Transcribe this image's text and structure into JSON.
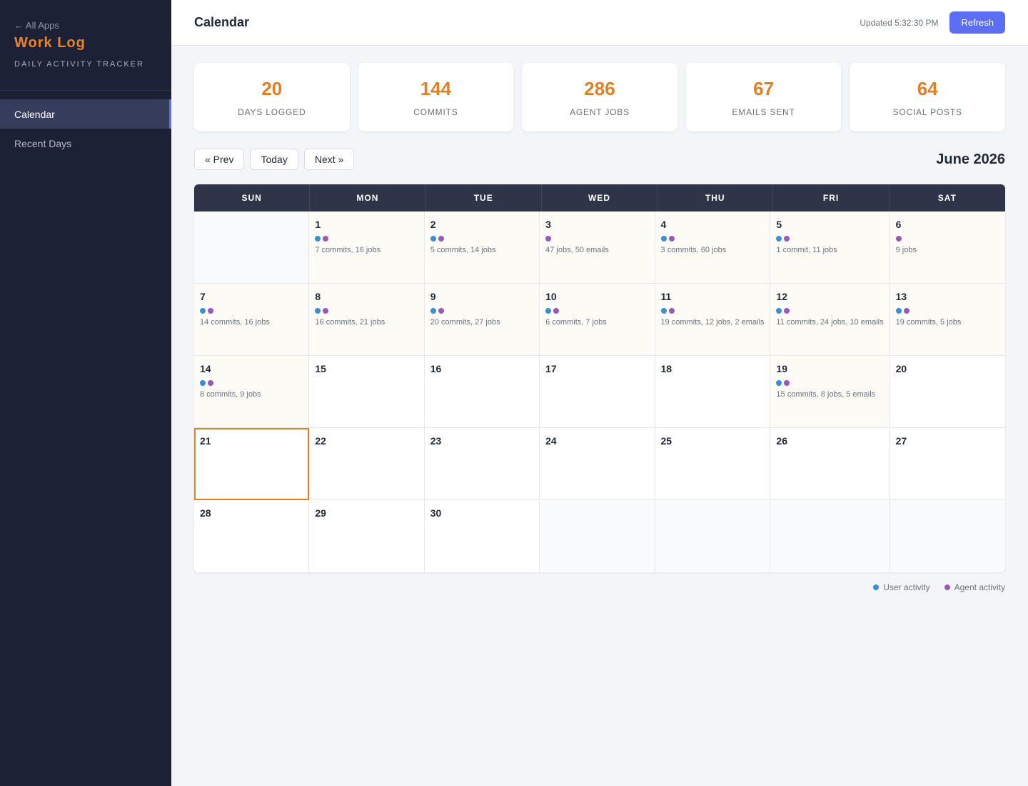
{
  "sidebar": {
    "back_link": "← All Apps",
    "title": "Work Log",
    "subtitle": "DAILY ACTIVITY TRACKER",
    "nav": [
      {
        "label": "Calendar",
        "active": true
      },
      {
        "label": "Recent Days",
        "active": false
      }
    ]
  },
  "header": {
    "title": "Calendar",
    "updated": "Updated 5:32:30 PM",
    "refresh_label": "Refresh"
  },
  "stats": [
    {
      "value": "20",
      "label": "DAYS LOGGED"
    },
    {
      "value": "144",
      "label": "COMMITS"
    },
    {
      "value": "286",
      "label": "AGENT JOBS"
    },
    {
      "value": "67",
      "label": "EMAILS SENT"
    },
    {
      "value": "64",
      "label": "SOCIAL POSTS"
    }
  ],
  "controls": {
    "prev_label": "« Prev",
    "today_label": "Today",
    "next_label": "Next »",
    "month_title": "June 2026"
  },
  "calendar": {
    "weekdays": [
      "SUN",
      "MON",
      "TUE",
      "WED",
      "THU",
      "FRI",
      "SAT"
    ],
    "leading_blanks": 1,
    "trailing_blanks": 4,
    "today": 21,
    "days": [
      {
        "day": "1",
        "user": true,
        "agent": true,
        "summary": "7 commits, 16 jobs"
      },
      {
        "day": "2",
        "user": true,
        "agent": true,
        "summary": "5 commits, 14 jobs"
      },
      {
        "day": "3",
        "user": false,
        "agent": true,
        "summary": "47 jobs, 50 emails"
      },
      {
        "day": "4",
        "user": true,
        "agent": true,
        "summary": "3 commits, 60 jobs"
      },
      {
        "day": "5",
        "user": true,
        "agent": true,
        "summary": "1 commit, 11 jobs"
      },
      {
        "day": "6",
        "user": false,
        "agent": true,
        "summary": "9 jobs"
      },
      {
        "day": "7",
        "user": true,
        "agent": true,
        "summary": "14 commits, 16 jobs"
      },
      {
        "day": "8",
        "user": true,
        "agent": true,
        "summary": "16 commits, 21 jobs"
      },
      {
        "day": "9",
        "user": true,
        "agent": true,
        "summary": "20 commits, 27 jobs"
      },
      {
        "day": "10",
        "user": true,
        "agent": true,
        "summary": "6 commits, 7 jobs"
      },
      {
        "day": "11",
        "user": true,
        "agent": true,
        "summary": "19 commits, 12 jobs, 2 emails"
      },
      {
        "day": "12",
        "user": true,
        "agent": true,
        "summary": "11 commits, 24 jobs, 10 emails"
      },
      {
        "day": "13",
        "user": true,
        "agent": true,
        "summary": "19 commits, 5 jobs"
      },
      {
        "day": "14",
        "user": true,
        "agent": true,
        "summary": "8 commits, 9 jobs"
      },
      {
        "day": "15"
      },
      {
        "day": "16"
      },
      {
        "day": "17"
      },
      {
        "day": "18"
      },
      {
        "day": "19",
        "user": true,
        "agent": true,
        "summary": "15 commits, 8 jobs, 5 emails"
      },
      {
        "day": "20"
      },
      {
        "day": "21"
      },
      {
        "day": "22"
      },
      {
        "day": "23"
      },
      {
        "day": "24"
      },
      {
        "day": "25"
      },
      {
        "day": "26"
      },
      {
        "day": "27"
      },
      {
        "day": "28"
      },
      {
        "day": "29"
      },
      {
        "day": "30"
      }
    ]
  },
  "legend": [
    {
      "label": "User activity",
      "type": "user",
      "color": "#3a8fd1"
    },
    {
      "label": "Agent activity",
      "type": "agent",
      "color": "#9b59b6"
    }
  ],
  "colors": {
    "accent": "#e07f2a",
    "primary": "#5b6ef5",
    "sidebar_bg": "#1c2136",
    "calendar_header_bg": "#2e3548"
  }
}
